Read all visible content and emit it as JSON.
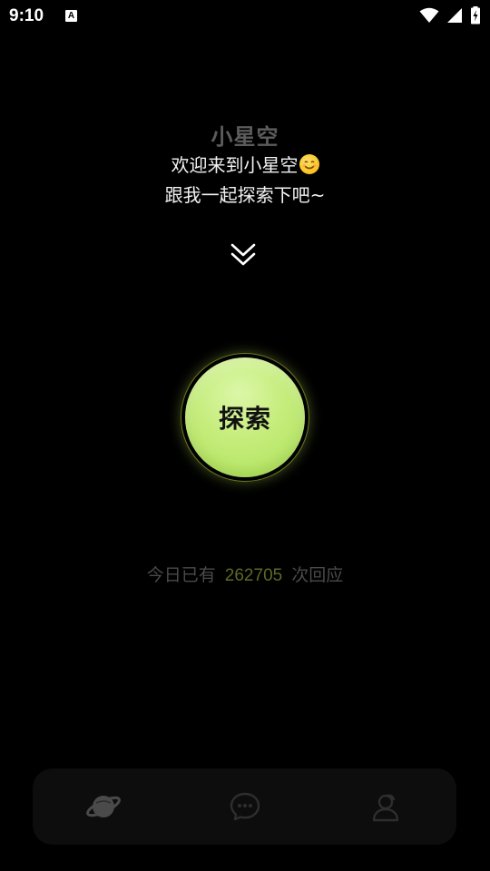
{
  "status_bar": {
    "time": "9:10",
    "badge": "A"
  },
  "header": {
    "title": "小星空",
    "welcome": "欢迎来到小星空",
    "subtitle": "跟我一起探索下吧~"
  },
  "explore": {
    "label": "探索"
  },
  "counter": {
    "prefix": "今日已有",
    "value": "262705",
    "suffix": "次回应"
  },
  "nav": {
    "items": [
      {
        "name": "planet",
        "icon": "planet-icon",
        "active": true
      },
      {
        "name": "chat",
        "icon": "chat-bubble-icon",
        "active": false
      },
      {
        "name": "profile",
        "icon": "profile-icon",
        "active": false
      }
    ]
  },
  "colors": {
    "background": "#000000",
    "accent_green": "#c4ec7a",
    "counter_number": "#5c6a24",
    "title_gray": "#5c5c5c"
  }
}
